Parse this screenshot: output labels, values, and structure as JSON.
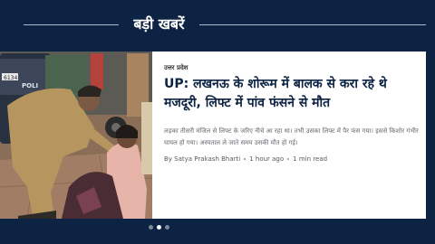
{
  "section": {
    "title": "बड़ी खबरें"
  },
  "story": {
    "category": "उत्तर प्रदेश",
    "headline": "UP: लखनऊ के शोरूम में बालक से करा रहे थे मजदूरी, लिफ्ट में पांव फंसने से मौत",
    "summary": "लड़का तीसरी मंजिल से लिफ्ट के जरिए नीचे आ रहा था। तभी उसका लिफ्ट में पैर फंस गया। इससे किशोर गंभीर घायल हो गया। अस्पताल ले जाते समय उसकी मौत हो गई।",
    "author": "By Satya Prakash Bharti",
    "time_ago": "1 hour ago",
    "read_time": "1 min read"
  },
  "photo": {
    "vehicle_plate": "6134",
    "vehicle_text": "POLI"
  },
  "pager": {
    "count": 3,
    "active_index": 1
  },
  "colors": {
    "background": "#0d2343",
    "card": "#ffffff",
    "headline": "#0d2343"
  }
}
